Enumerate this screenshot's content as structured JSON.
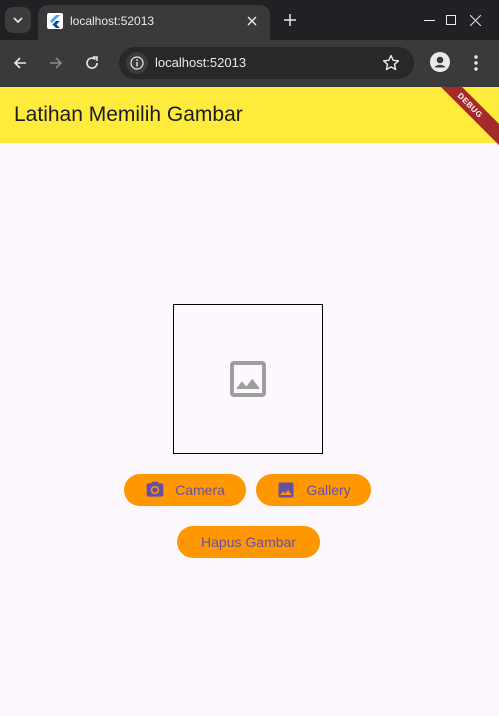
{
  "browser": {
    "tab_title": "localhost:52013",
    "url": "localhost:52013"
  },
  "app": {
    "title": "Latihan Memilih Gambar",
    "debug_label": "DEBUG"
  },
  "buttons": {
    "camera": "Camera",
    "gallery": "Gallery",
    "hapus": "Hapus Gambar"
  },
  "icons": {
    "camera": "photo-camera-icon",
    "gallery": "image-icon",
    "placeholder": "image-placeholder-icon"
  },
  "colors": {
    "appbar": "#ffeb3b",
    "button_bg": "#ff9800",
    "button_text": "#6750a4",
    "page_bg": "#fdf7fe",
    "debug": "#a52a2a"
  }
}
